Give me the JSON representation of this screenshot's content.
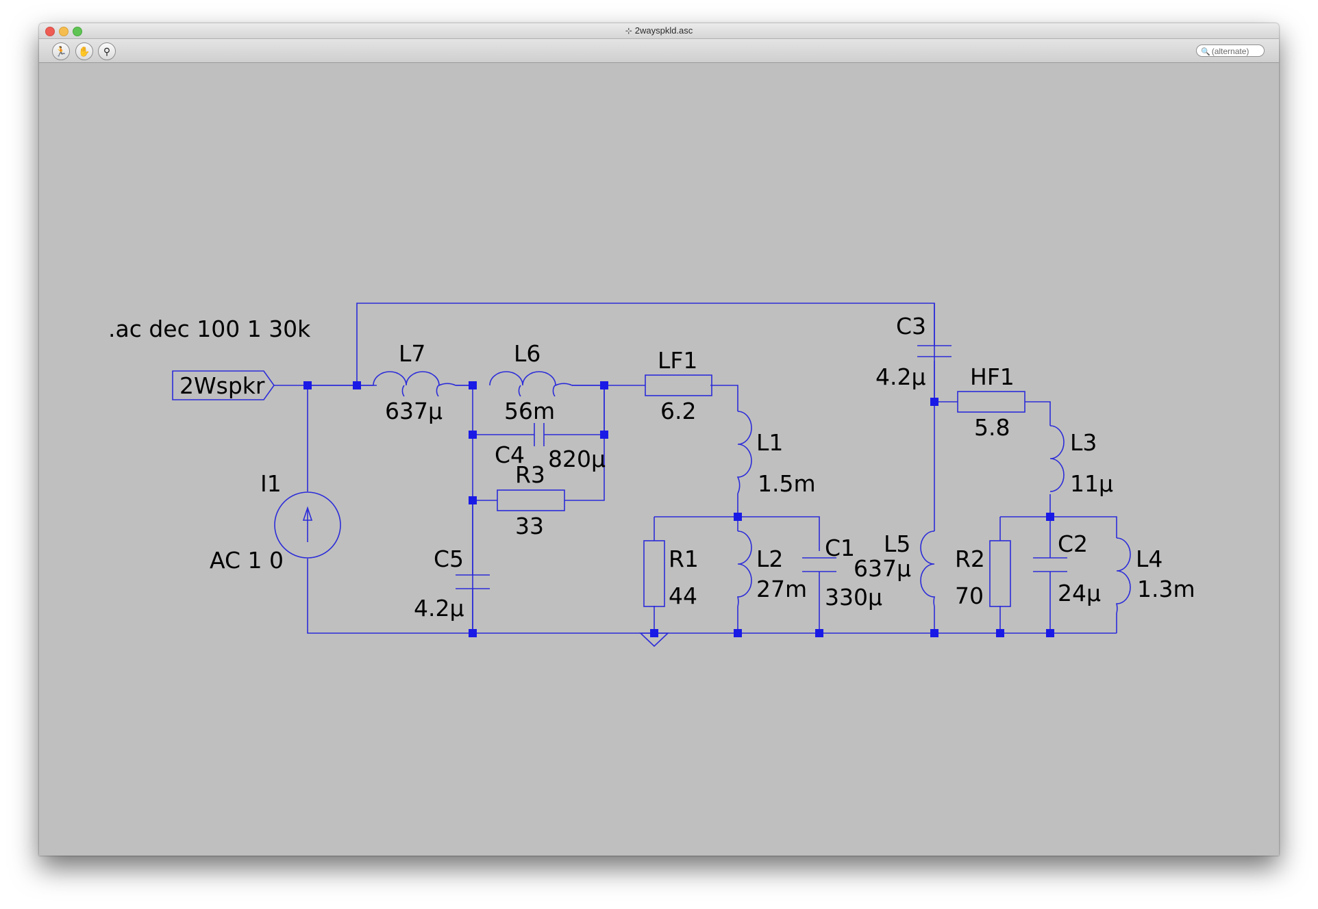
{
  "window": {
    "title": "2wayspkld.asc",
    "title_icon": "probe-icon"
  },
  "toolbar": {
    "buttons": [
      {
        "name": "run-button",
        "icon": "running-man-icon",
        "glyph": "🏃"
      },
      {
        "name": "halt-button",
        "icon": "hand-icon",
        "glyph": "✋"
      },
      {
        "name": "probe-button",
        "icon": "probe-icon",
        "glyph": "⚲"
      }
    ],
    "search_placeholder": "(alternate)"
  },
  "schematic": {
    "directive": ".ac dec 100 1 30k",
    "port": "2Wspkr",
    "source": {
      "name": "I1",
      "value": "AC 1 0"
    },
    "L7": {
      "name": "L7",
      "value": "637µ"
    },
    "L6": {
      "name": "L6",
      "value": "56m"
    },
    "C4": {
      "name": "C4",
      "value": "820µ"
    },
    "R3": {
      "name": "R3",
      "value": "33"
    },
    "C5": {
      "name": "C5",
      "value": "4.2µ"
    },
    "LF1": {
      "name": "LF1",
      "value": "6.2"
    },
    "L1": {
      "name": "L1",
      "value": "1.5m"
    },
    "R1": {
      "name": "R1",
      "value": "44"
    },
    "L2": {
      "name": "L2",
      "value": "27m"
    },
    "C1": {
      "name": "C1",
      "value": "330µ"
    },
    "C3": {
      "name": "C3",
      "value": "4.2µ"
    },
    "HF1": {
      "name": "HF1",
      "value": "5.8"
    },
    "L3": {
      "name": "L3",
      "value": "11µ"
    },
    "L5": {
      "name": "L5",
      "value": "637µ"
    },
    "R2": {
      "name": "R2",
      "value": "70"
    },
    "C2": {
      "name": "C2",
      "value": "24µ"
    },
    "L4": {
      "name": "L4",
      "value": "1.3m"
    }
  },
  "colors": {
    "wire": "#2b2bd9",
    "junction": "#1a1ae6",
    "canvas": "#bfbfbf"
  }
}
